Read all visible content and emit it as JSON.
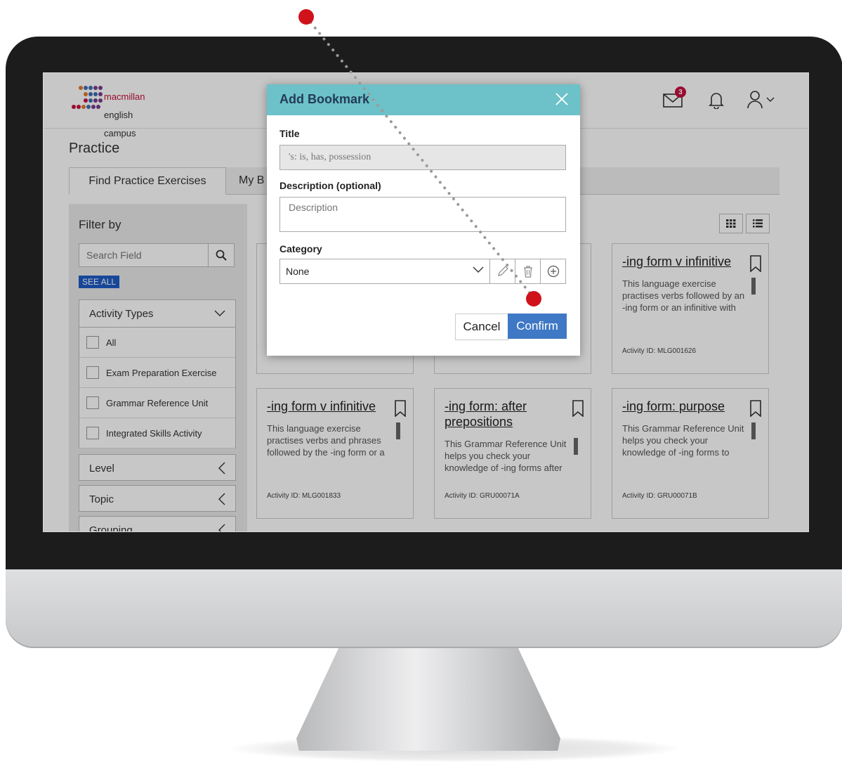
{
  "app": {
    "logo": {
      "line1": "macmillan",
      "line2": "english",
      "line3": "campus"
    },
    "header": {
      "mail_badge": "3"
    }
  },
  "page": {
    "title": "Practice",
    "tabs": [
      "Find Practice Exercises",
      "My B"
    ]
  },
  "filter": {
    "title": "Filter by",
    "search_placeholder": "Search Field",
    "see_all": "SEE ALL",
    "activity_types": {
      "label": "Activity Types",
      "options": [
        "All",
        "Exam Preparation Exercise",
        "Grammar Reference Unit",
        "Integrated Skills Activity"
      ]
    },
    "sections": [
      "Level",
      "Topic",
      "Grouping"
    ]
  },
  "cards": [
    {
      "title": "-ing form v infinitive",
      "desc": "This language exercise practises verbs followed by an -ing form or an infinitive with",
      "id": "Activity ID: MLG001626"
    },
    {
      "title": "-ing form v infinitive",
      "desc": "This language exercise practises verbs and phrases followed by the -ing form or a",
      "id": "Activity ID: MLG001833"
    },
    {
      "title": "-ing form: after prepositions",
      "desc": "This Grammar Reference Unit helps you check your knowledge of -ing forms after",
      "id": "Activity ID: GRU00071A"
    },
    {
      "title": "-ing form: purpose",
      "desc": "This Grammar Reference Unit helps you check your knowledge of -ing forms to",
      "id": "Activity ID: GRU00071B"
    }
  ],
  "modal": {
    "title": "Add Bookmark",
    "title_label": "Title",
    "title_value": "'s: is, has, possession",
    "description_label": "Description (optional)",
    "description_placeholder": "Description",
    "category_label": "Category",
    "category_value": "None",
    "cancel": "Cancel",
    "confirm": "Confirm"
  },
  "colors": {
    "modal_header": "#6cc2c8",
    "confirm": "#3f78c5",
    "see_all": "#1f5bc4",
    "brand_red": "#c4103d",
    "annotation": "#d0121b"
  }
}
